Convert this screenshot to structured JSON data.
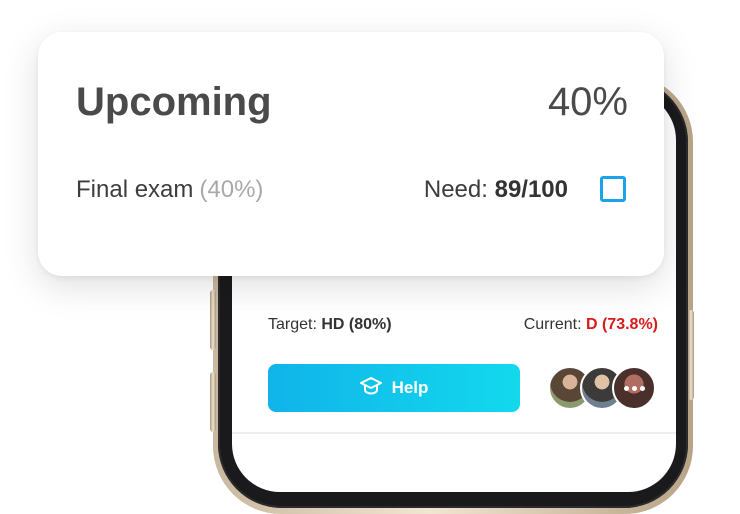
{
  "card": {
    "title": "Upcoming",
    "percent": "40%",
    "assessment_name": "Final exam",
    "assessment_weight": "(40%)",
    "need_label": "Need:",
    "need_value": "89/100",
    "checked": false
  },
  "grade_summary": {
    "target_label": "Target:",
    "target_value": "HD (80%)",
    "current_label": "Current:",
    "current_value": "D (73.8%)"
  },
  "help": {
    "label": "Help",
    "icon": "graduation-cap-icon"
  },
  "avatars": [
    "avatar",
    "avatar",
    "more-avatar"
  ],
  "colors": {
    "accent": "#1aa3e8",
    "help_gradient_start": "#10b4ea",
    "help_gradient_end": "#13d9ec",
    "current_grade": "#d81b1b",
    "weight_text": "#a9a9a9"
  }
}
